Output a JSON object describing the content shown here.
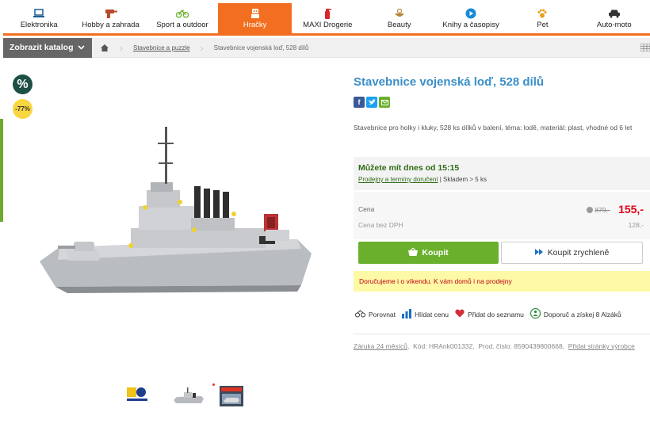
{
  "nav": {
    "categories": [
      {
        "label": "Elektronika",
        "icon": "laptop-icon"
      },
      {
        "label": "Hobby a zahrada",
        "icon": "drill-icon"
      },
      {
        "label": "Sport a outdoor",
        "icon": "bicycle-icon"
      },
      {
        "label": "Hračky",
        "icon": "robot-icon",
        "active": true
      },
      {
        "label": "MAXI Drogerie",
        "icon": "spray-bottle-icon"
      },
      {
        "label": "Beauty",
        "icon": "beauty-bowl-icon"
      },
      {
        "label": "Knihy a časopisy",
        "icon": "play-icon"
      },
      {
        "label": "Pet",
        "icon": "paw-icon"
      },
      {
        "label": "Auto-moto",
        "icon": "car-icon"
      }
    ],
    "accent": "#f26f21"
  },
  "subbar": {
    "catalog_label": "Zobrazit katalog",
    "breadcrumb": [
      {
        "label": "Stavebnice a puzzle",
        "link": true
      },
      {
        "label": "Stavebnice vojenská loď, 528 dílů",
        "link": false
      }
    ]
  },
  "badges": {
    "percent_symbol": "%",
    "discount": "-77%"
  },
  "product": {
    "title": "Stavebnice vojenská loď, 528 dílů",
    "description": "Stavebnice pro holky i kluky, 528 ks dílků v balení, téma: lodě, materiál: plast, vhodné od 6 let",
    "availability": {
      "headline": "Můžete mít dnes od 15:15",
      "delivery_link": "Prodejny a termíny doručení",
      "stock": " | Skladem > 5 ks"
    },
    "price": {
      "label": "Cena",
      "old": "879,-",
      "new": "155,-",
      "without_vat_label": "Cena bez DPH",
      "without_vat": "128,-"
    },
    "buy_label": "Koupit",
    "quick_buy_label": "Koupit zrychleně",
    "delivery_note": "Doručujeme i o víkendu. K vám domů i na prodejny",
    "actions": {
      "compare": "Porovnat",
      "watch_price": "Hlídat cenu",
      "add_to_list": "Přidat do seznamu",
      "recommend": "Doporuč a získej 8 Alzáků"
    },
    "meta": {
      "warranty": "Záruka 24 měsíců",
      "code": "Kód: HRAnk001332",
      "part_number": "Prod. číslo: 8590439800668",
      "manufacturer_link": "Přidat stránky výrobce"
    }
  },
  "colors": {
    "title": "#3b8fc8",
    "buy_button": "#6ab02c",
    "price": "#e0001b",
    "delivery_bg": "#fef9a4"
  }
}
